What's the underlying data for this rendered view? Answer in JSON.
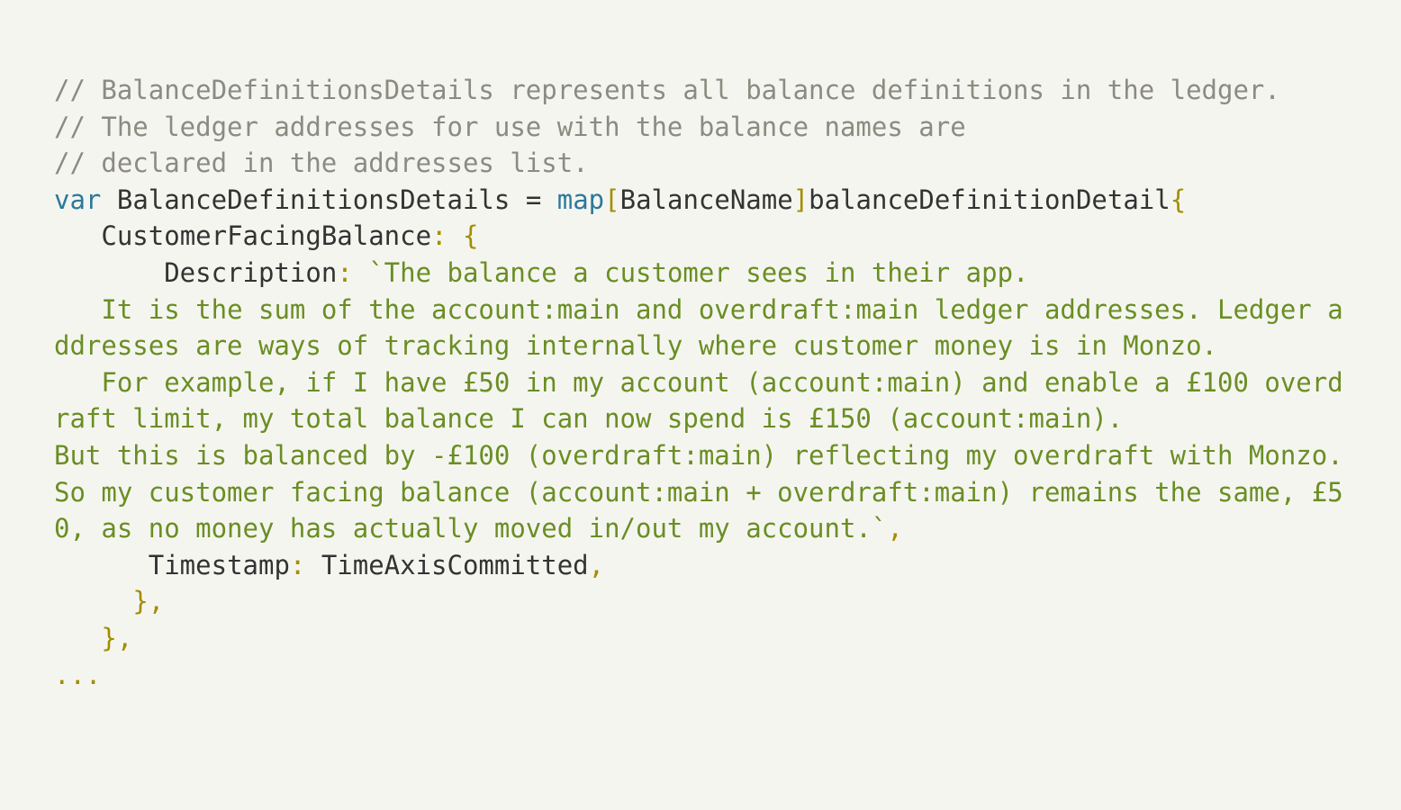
{
  "code": {
    "comment_lines": [
      "// BalanceDefinitionsDetails represents all balance definitions in the ledger.",
      "// The ledger addresses for use with the balance names are",
      "// declared in the addresses list."
    ],
    "kw_var": "var",
    "var_name": "BalanceDefinitionsDetails",
    "eq": " = ",
    "kw_map": "map",
    "lbracket": "[",
    "map_key_type": "BalanceName",
    "rbracket": "]",
    "map_val_type": "balanceDefinitionDetail",
    "lbrace": "{",
    "entry_key": "   CustomerFacingBalance",
    "colon_space": ": ",
    "lbrace2": "{",
    "desc_key": "       Description",
    "backtick_open": "`",
    "desc_string_first": "The balance a customer sees in their app.",
    "desc_string_line2": "   It is the sum of the account:main and overdraft:main ledger addresses. Ledger addresses are ways of tracking internally where customer money is in Monzo.",
    "desc_string_line3": "   For example, if I have £50 in my account (account:main) and enable a £100 overdraft limit, my total balance I can now spend is £150 (account:main).",
    "desc_string_line4": "But this is balanced by -£100 (overdraft:main) reflecting my overdraft with Monzo. So my customer facing balance (account:main + overdraft:main) remains the same, £50, as no money has actually moved in/out my account.",
    "backtick_close": "`",
    "comma": ",",
    "ts_key": "      Timestamp",
    "ts_val": " TimeAxisCommitted",
    "close_inner": "     },",
    "close_outer": "   },",
    "ellipsis": "..."
  }
}
